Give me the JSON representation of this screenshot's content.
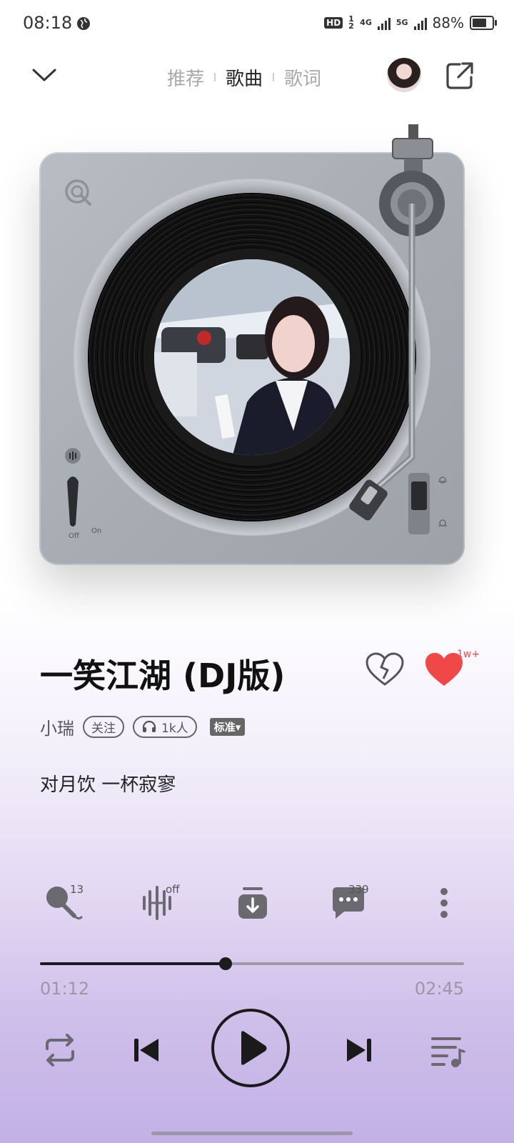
{
  "status_bar": {
    "time": "08:18",
    "hd_label": "HD",
    "hd_sub": "1 2",
    "net1": "4G",
    "net2": "5G",
    "battery_text": "88%",
    "battery_level": 0.88
  },
  "header": {
    "tabs": [
      "推荐",
      "歌曲",
      "歌词"
    ],
    "active_tab": 1,
    "icons": [
      "chevron-down-icon",
      "avatar",
      "share-icon"
    ]
  },
  "turntable": {
    "switch_off_label": "Off",
    "switch_on_label": "On"
  },
  "song": {
    "title": "一笑江湖 (DJ版)",
    "artist": "小瑞",
    "follow_label": "关注",
    "listeners_label": "1k人",
    "quality_label": "标准",
    "like_count": "1w+",
    "lyric_line": "对月饮 一杯寂寥"
  },
  "actions": {
    "karaoke_count": "13",
    "sound_effect_label": "off",
    "comments_count": "339"
  },
  "progress": {
    "current": "01:12",
    "total": "02:45",
    "fraction": 0.437
  },
  "colors": {
    "heart": "#f04848",
    "accent_dark": "#1c1c1c"
  }
}
